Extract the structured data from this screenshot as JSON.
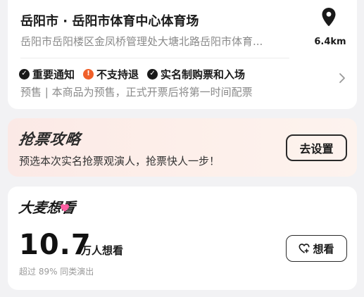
{
  "venue": {
    "title": "岳阳市 · 岳阳市体育中心体育场",
    "address": "岳阳市岳阳楼区金凤桥管理处大塘北路岳阳市体育...",
    "distance": "6.4km",
    "icon": "location-pin-icon"
  },
  "notices": [
    {
      "label": "重要通知",
      "icon": "check-circle-icon",
      "color": "#1a1a1a"
    },
    {
      "label": "不支持退",
      "icon": "exclamation-circle-icon",
      "color": "#f0602a"
    },
    {
      "label": "实名制购票和入场",
      "icon": "check-circle-icon",
      "color": "#1a1a1a"
    }
  ],
  "presale": "预售 | 本商品为预售，正式开票后将第一时间配票",
  "strategy": {
    "title": "抢票攻略",
    "description": "预选本次实名抢票观演人，抢票快人一步！",
    "button_label": "去设置"
  },
  "want": {
    "title": "大麦想看",
    "count": "10.7",
    "unit": "万人想看",
    "sub": "超过 89% 同类演出",
    "button_label": "想看",
    "accent": "#ff5fa2"
  }
}
